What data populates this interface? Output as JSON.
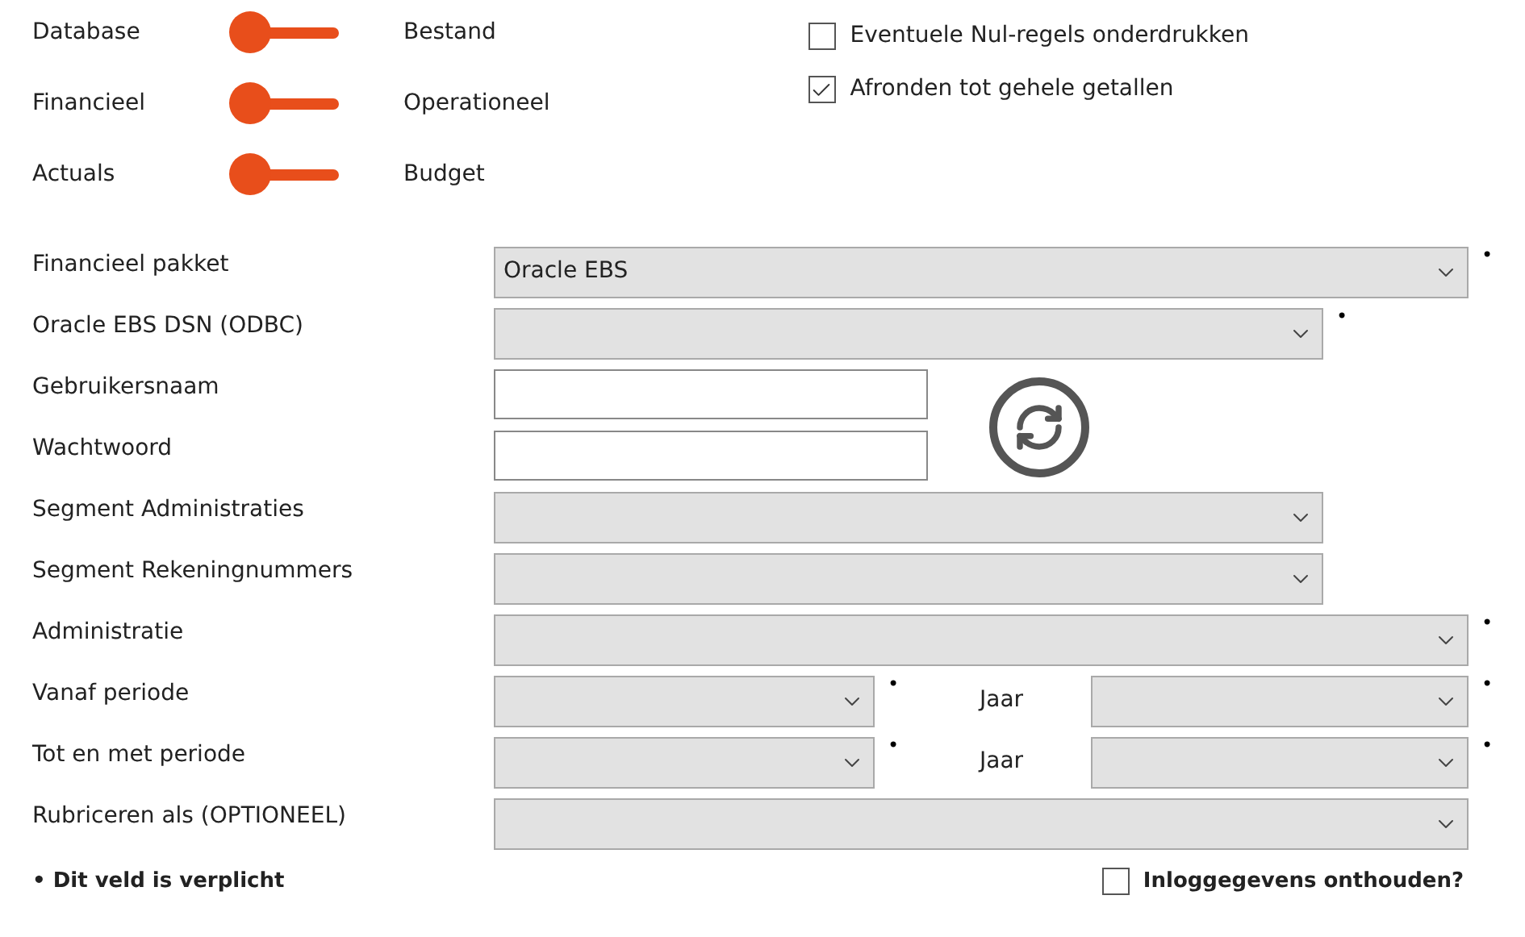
{
  "switches": [
    {
      "left": "Database",
      "right": "Bestand",
      "on": false
    },
    {
      "left": "Financieel",
      "right": "Operationeel",
      "on": false
    },
    {
      "left": "Actuals",
      "right": "Budget",
      "on": false
    }
  ],
  "options": [
    {
      "label": "Eventuele Nul-regels onderdrukken",
      "checked": false
    },
    {
      "label": "Afronden tot gehele getallen",
      "checked": true
    }
  ],
  "rows": [
    {
      "kind": "wide_select",
      "label": "Financieel pakket",
      "value": "Oracle EBS",
      "marker": "•"
    },
    {
      "kind": "select",
      "label": "Oracle EBS DSN (ODBC)",
      "marker": "•"
    },
    {
      "kind": "text",
      "label": "Gebruikersnaam"
    },
    {
      "kind": "text",
      "label": "Wachtwoord"
    },
    {
      "kind": "select",
      "label": "Segment Administraties"
    },
    {
      "kind": "select",
      "label": "Segment Rekeningnummers"
    },
    {
      "kind": "wide_select",
      "label": "Administratie",
      "marker": "•"
    },
    {
      "kind": "period",
      "label": "Vanaf periode",
      "marker": "•",
      "year_label": "Jaar",
      "year_marker": "•"
    },
    {
      "kind": "period",
      "label": "Tot en met periode",
      "marker": "•",
      "year_label": "Jaar",
      "year_marker": "•"
    },
    {
      "kind": "wide_select",
      "label": "Rubriceren als (OPTIONEEL)"
    }
  ],
  "footer": {
    "note": "• Dit veld is verplicht",
    "remember": {
      "label": "Inloggegevens onthouden?",
      "checked": false
    }
  }
}
